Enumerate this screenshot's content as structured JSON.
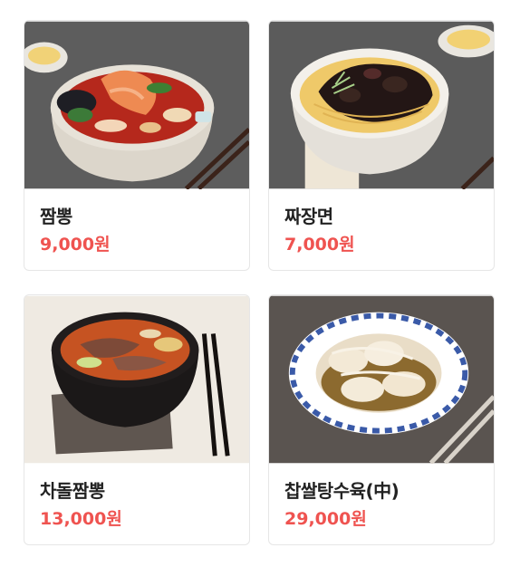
{
  "menu": {
    "items": [
      {
        "name": "짬뽕",
        "price": "9,000원",
        "image_icon": "jjamppong-bowl-photo"
      },
      {
        "name": "짜장면",
        "price": "7,000원",
        "image_icon": "jajangmyeon-bowl-photo"
      },
      {
        "name": "차돌짬뽕",
        "price": "13,000원",
        "image_icon": "chadol-jjamppong-bowl-photo"
      },
      {
        "name": "찹쌀탕수육(中)",
        "price": "29,000원",
        "image_icon": "tangsuyuk-plate-photo"
      }
    ]
  },
  "colors": {
    "price": "#ef5350",
    "name": "#222222",
    "border": "#e6e6e6"
  }
}
